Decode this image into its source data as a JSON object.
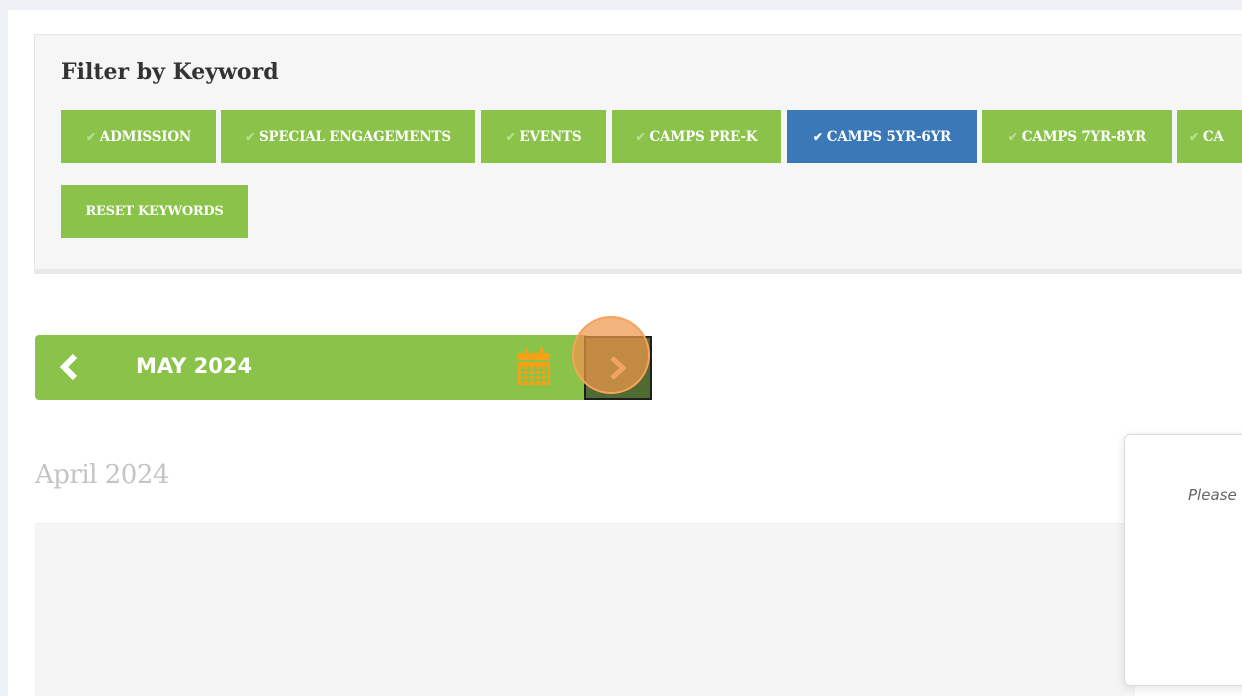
{
  "filter": {
    "title": "Filter by Keyword",
    "keywords": [
      {
        "label": "ADMISSION",
        "active": false
      },
      {
        "label": "SPECIAL ENGAGEMENTS",
        "active": false
      },
      {
        "label": "EVENTS",
        "active": false
      },
      {
        "label": "CAMPS PRE-K",
        "active": false
      },
      {
        "label": "CAMPS 5YR-6YR",
        "active": true
      },
      {
        "label": "CAMPS 7YR-8YR",
        "active": false
      },
      {
        "label": "CA",
        "active": false
      }
    ],
    "reset_label": "RESET KEYWORDS"
  },
  "calendar_nav": {
    "month_label": "MAY 2024",
    "prev_icon": "chevron-left-icon",
    "calendar_icon": "calendar-icon",
    "next_icon": "chevron-right-icon"
  },
  "section": {
    "heading": "April 2024"
  },
  "popup": {
    "text": "Please"
  },
  "colors": {
    "accent_green": "#8bc34a",
    "active_blue": "#3a78b8",
    "calendar_orange": "#f4a11a",
    "highlight_orange": "#ee964b"
  }
}
